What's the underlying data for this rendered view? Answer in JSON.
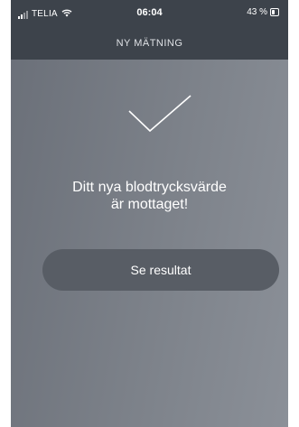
{
  "status_bar": {
    "carrier": "TELIA",
    "time": "06:04",
    "battery": "43 %",
    "battery_level": 0.43,
    "signal_icon": "cellular-signal-icon",
    "wifi_icon": "wifi-icon",
    "battery_icon": "battery-icon"
  },
  "header": {
    "title": "NY MÄTNING"
  },
  "main": {
    "success_icon": "checkmark-icon",
    "message_line1": "Ditt nya blodtrycksvärde",
    "message_line2": "är mottaget!",
    "button_label": "Se resultat"
  },
  "colors": {
    "bar_background": "#3d434b",
    "content_background": "#7c8189",
    "button_background": "#585d65",
    "text": "#ffffff"
  }
}
